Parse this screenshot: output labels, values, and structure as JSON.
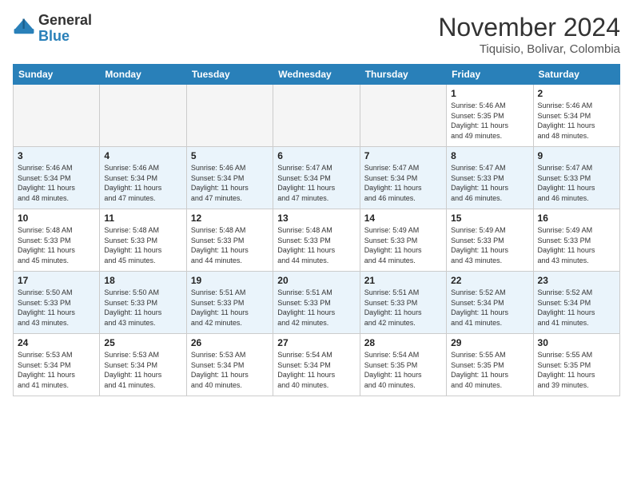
{
  "logo": {
    "general": "General",
    "blue": "Blue"
  },
  "header": {
    "month": "November 2024",
    "location": "Tiquisio, Bolivar, Colombia"
  },
  "weekdays": [
    "Sunday",
    "Monday",
    "Tuesday",
    "Wednesday",
    "Thursday",
    "Friday",
    "Saturday"
  ],
  "weeks": [
    [
      {
        "day": "",
        "info": ""
      },
      {
        "day": "",
        "info": ""
      },
      {
        "day": "",
        "info": ""
      },
      {
        "day": "",
        "info": ""
      },
      {
        "day": "",
        "info": ""
      },
      {
        "day": "1",
        "info": "Sunrise: 5:46 AM\nSunset: 5:35 PM\nDaylight: 11 hours\nand 49 minutes."
      },
      {
        "day": "2",
        "info": "Sunrise: 5:46 AM\nSunset: 5:34 PM\nDaylight: 11 hours\nand 48 minutes."
      }
    ],
    [
      {
        "day": "3",
        "info": "Sunrise: 5:46 AM\nSunset: 5:34 PM\nDaylight: 11 hours\nand 48 minutes."
      },
      {
        "day": "4",
        "info": "Sunrise: 5:46 AM\nSunset: 5:34 PM\nDaylight: 11 hours\nand 47 minutes."
      },
      {
        "day": "5",
        "info": "Sunrise: 5:46 AM\nSunset: 5:34 PM\nDaylight: 11 hours\nand 47 minutes."
      },
      {
        "day": "6",
        "info": "Sunrise: 5:47 AM\nSunset: 5:34 PM\nDaylight: 11 hours\nand 47 minutes."
      },
      {
        "day": "7",
        "info": "Sunrise: 5:47 AM\nSunset: 5:34 PM\nDaylight: 11 hours\nand 46 minutes."
      },
      {
        "day": "8",
        "info": "Sunrise: 5:47 AM\nSunset: 5:33 PM\nDaylight: 11 hours\nand 46 minutes."
      },
      {
        "day": "9",
        "info": "Sunrise: 5:47 AM\nSunset: 5:33 PM\nDaylight: 11 hours\nand 46 minutes."
      }
    ],
    [
      {
        "day": "10",
        "info": "Sunrise: 5:48 AM\nSunset: 5:33 PM\nDaylight: 11 hours\nand 45 minutes."
      },
      {
        "day": "11",
        "info": "Sunrise: 5:48 AM\nSunset: 5:33 PM\nDaylight: 11 hours\nand 45 minutes."
      },
      {
        "day": "12",
        "info": "Sunrise: 5:48 AM\nSunset: 5:33 PM\nDaylight: 11 hours\nand 44 minutes."
      },
      {
        "day": "13",
        "info": "Sunrise: 5:48 AM\nSunset: 5:33 PM\nDaylight: 11 hours\nand 44 minutes."
      },
      {
        "day": "14",
        "info": "Sunrise: 5:49 AM\nSunset: 5:33 PM\nDaylight: 11 hours\nand 44 minutes."
      },
      {
        "day": "15",
        "info": "Sunrise: 5:49 AM\nSunset: 5:33 PM\nDaylight: 11 hours\nand 43 minutes."
      },
      {
        "day": "16",
        "info": "Sunrise: 5:49 AM\nSunset: 5:33 PM\nDaylight: 11 hours\nand 43 minutes."
      }
    ],
    [
      {
        "day": "17",
        "info": "Sunrise: 5:50 AM\nSunset: 5:33 PM\nDaylight: 11 hours\nand 43 minutes."
      },
      {
        "day": "18",
        "info": "Sunrise: 5:50 AM\nSunset: 5:33 PM\nDaylight: 11 hours\nand 43 minutes."
      },
      {
        "day": "19",
        "info": "Sunrise: 5:51 AM\nSunset: 5:33 PM\nDaylight: 11 hours\nand 42 minutes."
      },
      {
        "day": "20",
        "info": "Sunrise: 5:51 AM\nSunset: 5:33 PM\nDaylight: 11 hours\nand 42 minutes."
      },
      {
        "day": "21",
        "info": "Sunrise: 5:51 AM\nSunset: 5:33 PM\nDaylight: 11 hours\nand 42 minutes."
      },
      {
        "day": "22",
        "info": "Sunrise: 5:52 AM\nSunset: 5:34 PM\nDaylight: 11 hours\nand 41 minutes."
      },
      {
        "day": "23",
        "info": "Sunrise: 5:52 AM\nSunset: 5:34 PM\nDaylight: 11 hours\nand 41 minutes."
      }
    ],
    [
      {
        "day": "24",
        "info": "Sunrise: 5:53 AM\nSunset: 5:34 PM\nDaylight: 11 hours\nand 41 minutes."
      },
      {
        "day": "25",
        "info": "Sunrise: 5:53 AM\nSunset: 5:34 PM\nDaylight: 11 hours\nand 41 minutes."
      },
      {
        "day": "26",
        "info": "Sunrise: 5:53 AM\nSunset: 5:34 PM\nDaylight: 11 hours\nand 40 minutes."
      },
      {
        "day": "27",
        "info": "Sunrise: 5:54 AM\nSunset: 5:34 PM\nDaylight: 11 hours\nand 40 minutes."
      },
      {
        "day": "28",
        "info": "Sunrise: 5:54 AM\nSunset: 5:35 PM\nDaylight: 11 hours\nand 40 minutes."
      },
      {
        "day": "29",
        "info": "Sunrise: 5:55 AM\nSunset: 5:35 PM\nDaylight: 11 hours\nand 40 minutes."
      },
      {
        "day": "30",
        "info": "Sunrise: 5:55 AM\nSunset: 5:35 PM\nDaylight: 11 hours\nand 39 minutes."
      }
    ]
  ]
}
